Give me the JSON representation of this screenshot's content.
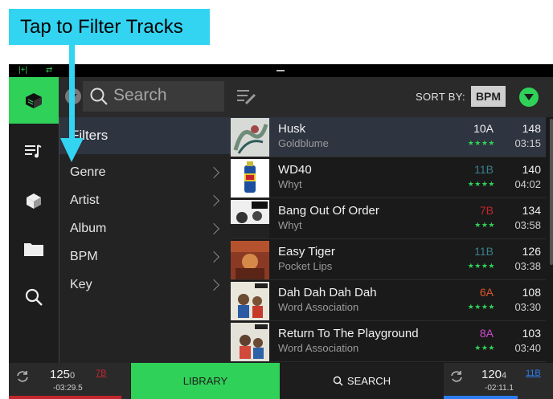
{
  "callout": {
    "text": "Tap to Filter Tracks"
  },
  "header": {
    "search_placeholder": "Search",
    "sort_label": "SORT BY:",
    "sort_value": "BPM"
  },
  "filters": {
    "title": "Filters",
    "items": [
      {
        "label": "Genre"
      },
      {
        "label": "Artist"
      },
      {
        "label": "Album"
      },
      {
        "label": "BPM"
      },
      {
        "label": "Key"
      }
    ]
  },
  "tracks": [
    {
      "title": "Husk",
      "artist": "Goldblume",
      "key": "10A",
      "key_color": "#f0f0f0",
      "stars": "★★★★",
      "star_color": "#30d158",
      "bpm": "148",
      "time": "03:15",
      "selected": true
    },
    {
      "title": "WD40",
      "artist": "Whyt",
      "key": "11B",
      "key_color": "#3a7f8a",
      "stars": "★★★★",
      "star_color": "#30d158",
      "bpm": "140",
      "time": "04:02"
    },
    {
      "title": "Bang Out Of Order",
      "artist": "Whyt",
      "key": "7B",
      "key_color": "#c1272d",
      "stars": "★★★",
      "star_color": "#30d158",
      "bpm": "134",
      "time": "03:58"
    },
    {
      "title": "Easy Tiger",
      "artist": "Pocket Lips",
      "key": "11B",
      "key_color": "#3a7f8a",
      "stars": "★★★★",
      "star_color": "#30d158",
      "bpm": "126",
      "time": "03:38"
    },
    {
      "title": "Dah Dah Dah Dah",
      "artist": "Word Association",
      "key": "6A",
      "key_color": "#e0562a",
      "stars": "★★★★",
      "star_color": "#30d158",
      "bpm": "108",
      "time": "03:30"
    },
    {
      "title": "Return To The Playground",
      "artist": "Word Association",
      "key": "8A",
      "key_color": "#d24ad2",
      "stars": "★★★",
      "star_color": "#30d158",
      "bpm": "103",
      "time": "03:40"
    }
  ],
  "decks": {
    "left": {
      "bpm_main": "125",
      "bpm_dec": "0",
      "time": "-03:29.5",
      "key": "7B",
      "key_color": "#c1272d"
    },
    "right": {
      "bpm_main": "120",
      "bpm_dec": "4",
      "time": "-02:11.1",
      "key": "11B",
      "key_color": "#2d7cf0"
    }
  },
  "tabs": {
    "library": "LIBRARY",
    "search": "SEARCH"
  },
  "colors": {
    "accent": "#30d158",
    "callout": "#33d4f2",
    "selected_row": "#2e3440"
  },
  "icons": {
    "rail": [
      "crate-icon",
      "playlist-icon",
      "prepare-icon",
      "folder-icon",
      "search-icon"
    ],
    "status": [
      "track-sync-icon",
      "repeat-icon"
    ]
  }
}
